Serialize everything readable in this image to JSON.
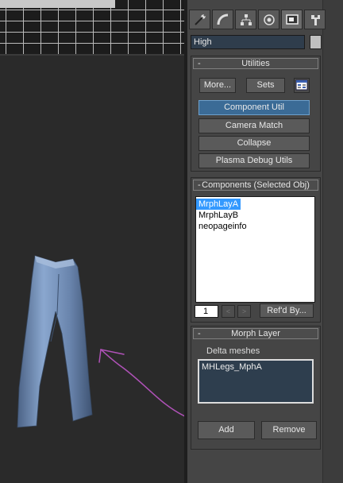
{
  "command_panel": {
    "tabs": [
      {
        "name": "create-tab-icon"
      },
      {
        "name": "modify-tab-icon"
      },
      {
        "name": "hierarchy-tab-icon"
      },
      {
        "name": "motion-tab-icon"
      },
      {
        "name": "display-tab-icon"
      },
      {
        "name": "utilities-tab-icon"
      }
    ],
    "object_name": "High",
    "object_color": "#c0c0c0"
  },
  "utilities": {
    "title": "Utilities",
    "more_label": "More...",
    "sets_label": "Sets",
    "buttons": [
      "Component Util",
      "Camera Match",
      "Collapse",
      "Plasma Debug Utils"
    ]
  },
  "components": {
    "title": "Components (Selected Obj)",
    "items": [
      "MrphLayA",
      "MrphLayB",
      "neopageinfo"
    ],
    "selected": "MrphLayA",
    "page": "1",
    "prev": "<",
    "next": ">",
    "refd_by_label": "Ref'd By..."
  },
  "morph_layer": {
    "title": "Morph Layer",
    "delta_label": "Delta meshes",
    "items": [
      "MHLegs_MphA"
    ],
    "add_label": "Add",
    "remove_label": "Remove"
  },
  "rollout_minus": "-",
  "colors": {
    "panel": "#454545",
    "viewport": "#2a2a2a",
    "highlight": "#3b6b96",
    "mesh": "#7f9cc4",
    "annotation": "#b052b8"
  }
}
